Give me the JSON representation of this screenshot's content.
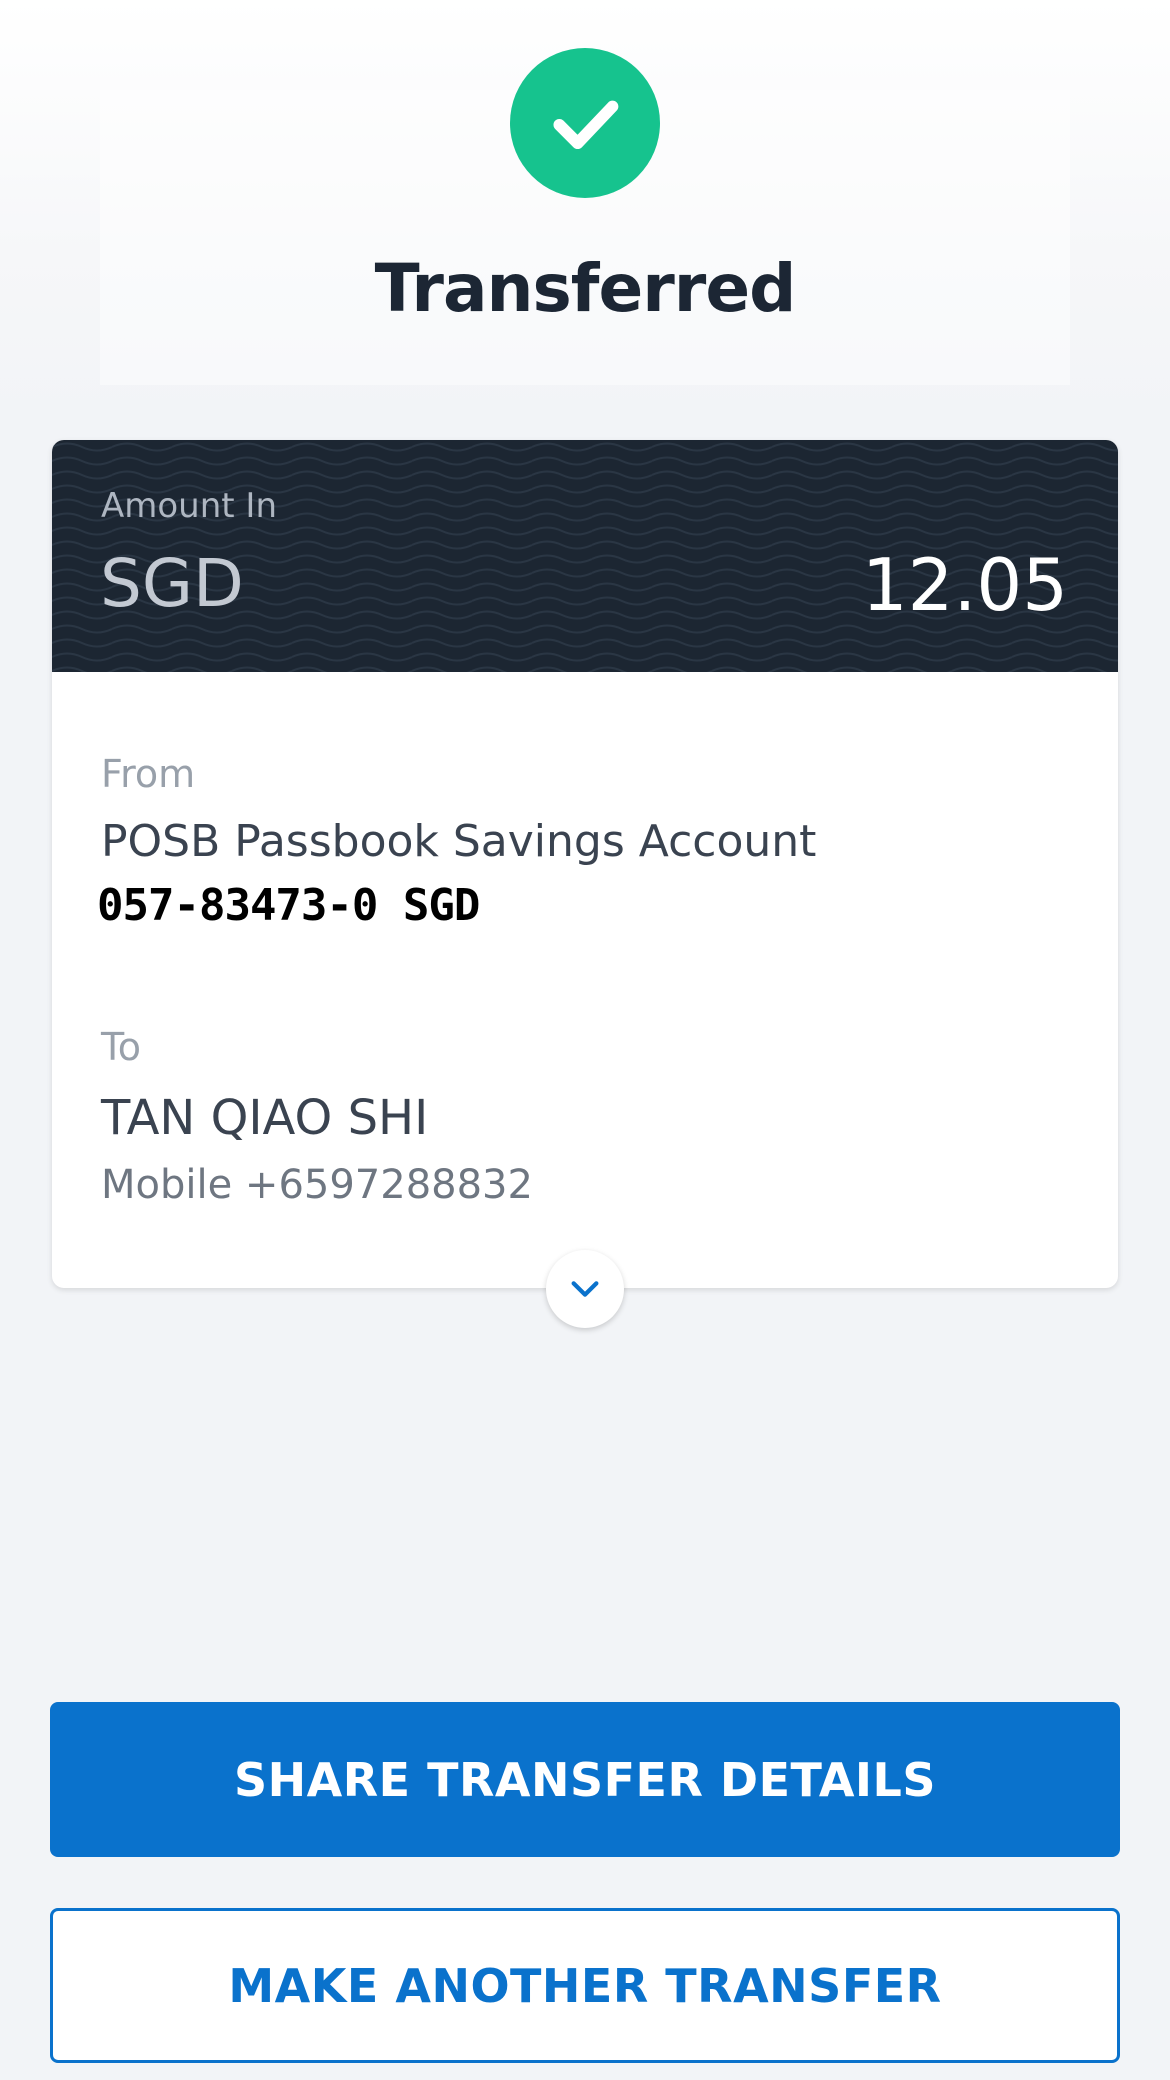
{
  "status": {
    "title": "Transferred",
    "icon": "checkmark-icon",
    "color": "#16C38E"
  },
  "amount": {
    "label": "Amount In",
    "currency": "SGD",
    "value": "12.05"
  },
  "from": {
    "label": "From",
    "account_name": "POSB Passbook Savings Account",
    "account_number": "057-83473-0 SGD"
  },
  "to": {
    "label": "To",
    "recipient_name": "TAN QIAO SHI",
    "recipient_mobile": "Mobile +6597288832"
  },
  "expand_icon": "chevron-down-icon",
  "actions": {
    "share_label": "SHARE TRANSFER DETAILS",
    "another_label": "MAKE ANOTHER TRANSFER"
  },
  "colors": {
    "accent": "#0A72CC",
    "card_header": "#1C2632",
    "success": "#16C38E"
  }
}
